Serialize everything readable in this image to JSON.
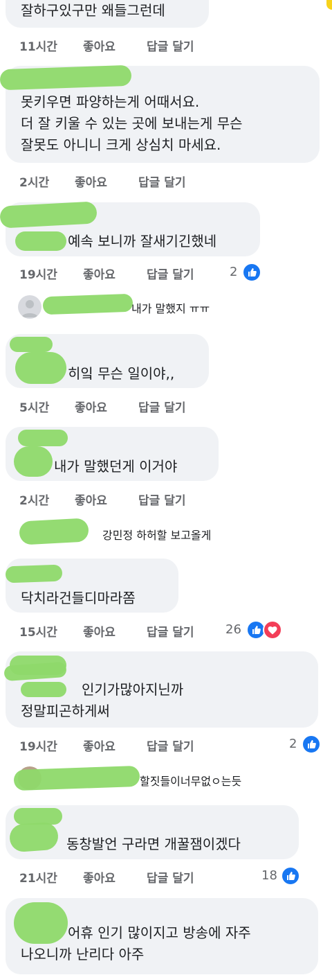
{
  "colors": {
    "bubble": "#f0f2f5",
    "meta": "#65676b",
    "like": "#1877f2",
    "love": "#f33e58",
    "redaction": "#8ed96a"
  },
  "actions": {
    "like": "좋아요",
    "reply": "답글 달기"
  },
  "comments": [
    {
      "lines": [
        "잘하구있구만 왜들그런데"
      ],
      "time": "11시간"
    },
    {
      "lines": [
        "못키우면 파양하는게 어때서요.",
        "더 잘 키울 수  있는 곳에 보내는게 무슨",
        "잘못도 아니니 크게 상심치 마세요."
      ],
      "time": "2시간"
    },
    {
      "lines": [
        "예속 보니까 잘새기긴했네"
      ],
      "time": "19시간",
      "reactions": {
        "count": "2",
        "icons": [
          "like-icon"
        ]
      },
      "reply": {
        "text": "내가 말했지 ㅠㅠ"
      }
    },
    {
      "lines": [
        "히잌 무슨 일이야,,"
      ],
      "time": "5시간"
    },
    {
      "lines": [
        "내가 말했던게 이거야"
      ],
      "time": "2시간",
      "reply": {
        "text": "강민정 하허할 보고올게"
      }
    },
    {
      "lines": [
        "닥치라건들디마라쫌"
      ],
      "time": "15시간",
      "reactions": {
        "count": "26",
        "icons": [
          "like-icon",
          "love-icon"
        ]
      }
    },
    {
      "lines": [
        "인기가많아지닌까",
        "정말피곤하게써"
      ],
      "time": "19시간",
      "reactions": {
        "count": "2",
        "icons": [
          "like-icon"
        ]
      },
      "reply": {
        "text": "할짓들이너무없ㅇ는듯"
      }
    },
    {
      "lines": [
        "동창발언 구라면 개꿀잼이겠다"
      ],
      "time": "21시간",
      "reactions": {
        "count": "18",
        "icons": [
          "like-icon"
        ]
      }
    },
    {
      "lines": [
        "어휴 인기 많이지고 방송에 자주",
        "나오니까 난리다 아주"
      ]
    }
  ]
}
